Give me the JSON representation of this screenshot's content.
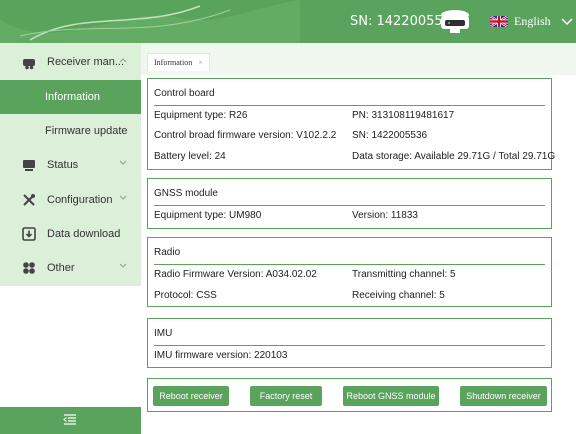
{
  "header": {
    "sn_text": "SN:  1422005536",
    "language": "English",
    "colors": {
      "brand": "#5aa35c",
      "sidebar_bg": "#dcefd9"
    }
  },
  "sidebar": {
    "items": [
      {
        "label": "Receiver man...",
        "icon": "receiver-icon"
      },
      {
        "label": "Information"
      },
      {
        "label": "Firmware update"
      },
      {
        "label": "Status",
        "icon": "status-icon"
      },
      {
        "label": "Configuration",
        "icon": "tools-icon"
      },
      {
        "label": "Data download",
        "icon": "download-icon"
      },
      {
        "label": "Other",
        "icon": "other-icon"
      }
    ]
  },
  "tabs": [
    {
      "label": "Information",
      "close": "×"
    }
  ],
  "control_board": {
    "title": "Control board",
    "equipment_type": "Equipment type: R26",
    "pn": "PN: 313108119481617",
    "firmware": "Control broad firmware version: V102.2.2",
    "sn": "SN: 1422005536",
    "battery": "Battery level: 24",
    "storage": "Data storage: Available 29.71G / Total 29.71G"
  },
  "gnss": {
    "title": "GNSS module",
    "equipment_type": "Equipment type: UM980",
    "version": "Version: 11833"
  },
  "radio": {
    "title": "Radio",
    "firmware": "Radio Firmware Version: A034.02.02",
    "tx_channel": "Transmitting channel: 5",
    "protocol": "Protocol: CSS",
    "rx_channel": "Receiving channel: 5"
  },
  "imu": {
    "title": "IMU",
    "firmware": "IMU firmware version: 220103"
  },
  "actions": {
    "reboot_receiver": "Reboot receiver",
    "factory_reset": "Factory reset",
    "reboot_gnss": "Reboot GNSS module",
    "shutdown": "Shutdown receiver"
  }
}
